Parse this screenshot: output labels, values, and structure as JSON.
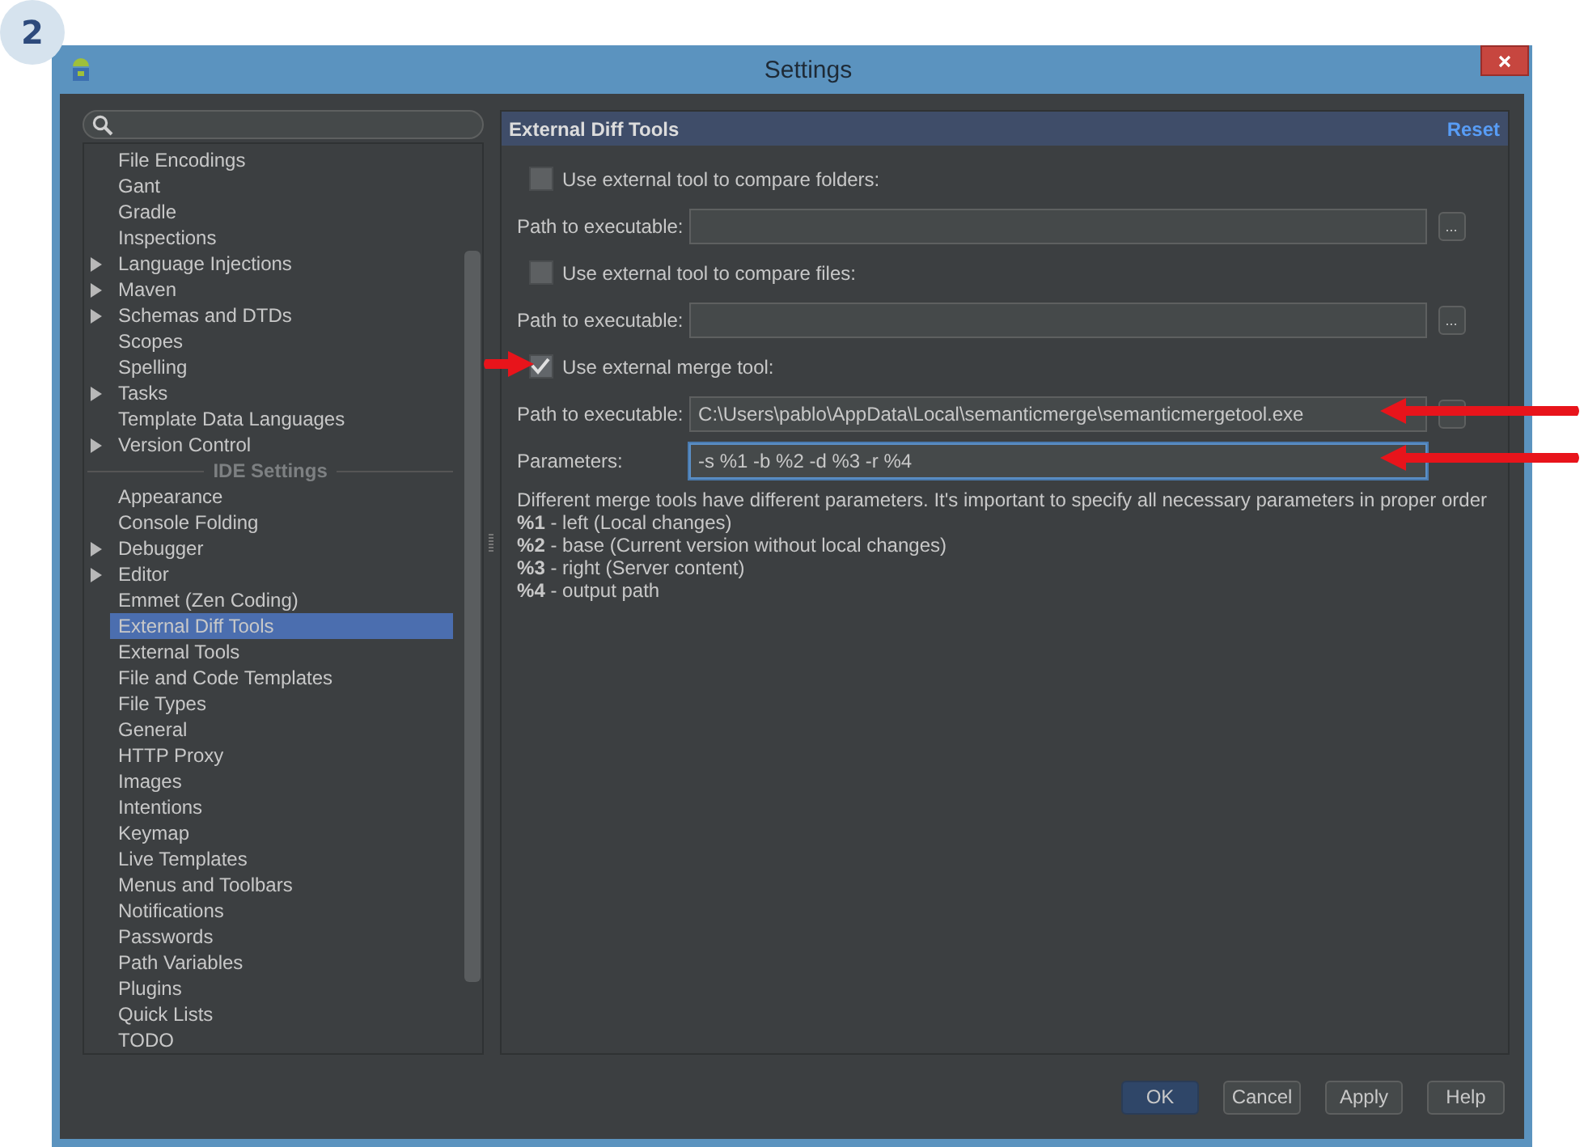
{
  "step_badge": "2",
  "window": {
    "title": "Settings"
  },
  "tree": {
    "groups": [
      {
        "items": [
          {
            "label": "File Encodings",
            "expandable": false,
            "selected": false
          },
          {
            "label": "Gant",
            "expandable": false,
            "selected": false
          },
          {
            "label": "Gradle",
            "expandable": false,
            "selected": false
          },
          {
            "label": "Inspections",
            "expandable": false,
            "selected": false
          },
          {
            "label": "Language Injections",
            "expandable": true,
            "selected": false
          },
          {
            "label": "Maven",
            "expandable": true,
            "selected": false
          },
          {
            "label": "Schemas and DTDs",
            "expandable": true,
            "selected": false
          },
          {
            "label": "Scopes",
            "expandable": false,
            "selected": false
          },
          {
            "label": "Spelling",
            "expandable": false,
            "selected": false
          },
          {
            "label": "Tasks",
            "expandable": true,
            "selected": false
          },
          {
            "label": "Template Data Languages",
            "expandable": false,
            "selected": false
          },
          {
            "label": "Version Control",
            "expandable": true,
            "selected": false
          }
        ]
      },
      {
        "heading": "IDE Settings",
        "items": [
          {
            "label": "Appearance",
            "expandable": false,
            "selected": false
          },
          {
            "label": "Console Folding",
            "expandable": false,
            "selected": false
          },
          {
            "label": "Debugger",
            "expandable": true,
            "selected": false
          },
          {
            "label": "Editor",
            "expandable": true,
            "selected": false
          },
          {
            "label": "Emmet (Zen Coding)",
            "expandable": false,
            "selected": false
          },
          {
            "label": "External Diff Tools",
            "expandable": false,
            "selected": true
          },
          {
            "label": "External Tools",
            "expandable": false,
            "selected": false
          },
          {
            "label": "File and Code Templates",
            "expandable": false,
            "selected": false
          },
          {
            "label": "File Types",
            "expandable": false,
            "selected": false
          },
          {
            "label": "General",
            "expandable": false,
            "selected": false
          },
          {
            "label": "HTTP Proxy",
            "expandable": false,
            "selected": false
          },
          {
            "label": "Images",
            "expandable": false,
            "selected": false
          },
          {
            "label": "Intentions",
            "expandable": false,
            "selected": false
          },
          {
            "label": "Keymap",
            "expandable": false,
            "selected": false
          },
          {
            "label": "Live Templates",
            "expandable": false,
            "selected": false
          },
          {
            "label": "Menus and Toolbars",
            "expandable": false,
            "selected": false
          },
          {
            "label": "Notifications",
            "expandable": false,
            "selected": false
          },
          {
            "label": "Passwords",
            "expandable": false,
            "selected": false
          },
          {
            "label": "Path Variables",
            "expandable": false,
            "selected": false
          },
          {
            "label": "Plugins",
            "expandable": false,
            "selected": false
          },
          {
            "label": "Quick Lists",
            "expandable": false,
            "selected": false
          },
          {
            "label": "TODO",
            "expandable": false,
            "selected": false
          }
        ]
      }
    ]
  },
  "panel": {
    "title": "External Diff Tools",
    "reset": "Reset",
    "rows": [
      {
        "kind": "checkbox",
        "label": "Use external tool to compare folders:",
        "checked": false
      },
      {
        "kind": "path",
        "label": "Path to executable:",
        "browse": "..."
      },
      {
        "kind": "checkbox",
        "label": "Use external tool to compare files:",
        "checked": false
      },
      {
        "kind": "path",
        "label": "Path to executable:",
        "browse": "..."
      },
      {
        "kind": "checkbox",
        "label": "Use external merge tool:",
        "checked": true
      },
      {
        "kind": "path",
        "label": "Path to executable:",
        "value": "C:\\Users\\pablo\\AppData\\Local\\semanticmerge\\semanticmergetool.exe",
        "browse_covered": true
      },
      {
        "kind": "path",
        "label": "Parameters:",
        "value": "-s %1 -b %2 -d %3 -r %4",
        "focused": true
      }
    ],
    "note": "Different merge tools have different parameters. It's important to specify all necessary parameters in proper order",
    "legend": [
      "**%1** - left (Local changes)",
      "**%2** - base (Current version without local changes)",
      "**%3** - right (Server content)",
      "**%4** - output path"
    ]
  },
  "buttons": [
    {
      "label": "OK",
      "default": true
    },
    {
      "label": "Cancel",
      "default": false
    },
    {
      "label": "Apply",
      "default": false
    },
    {
      "label": "Help",
      "default": false
    }
  ]
}
